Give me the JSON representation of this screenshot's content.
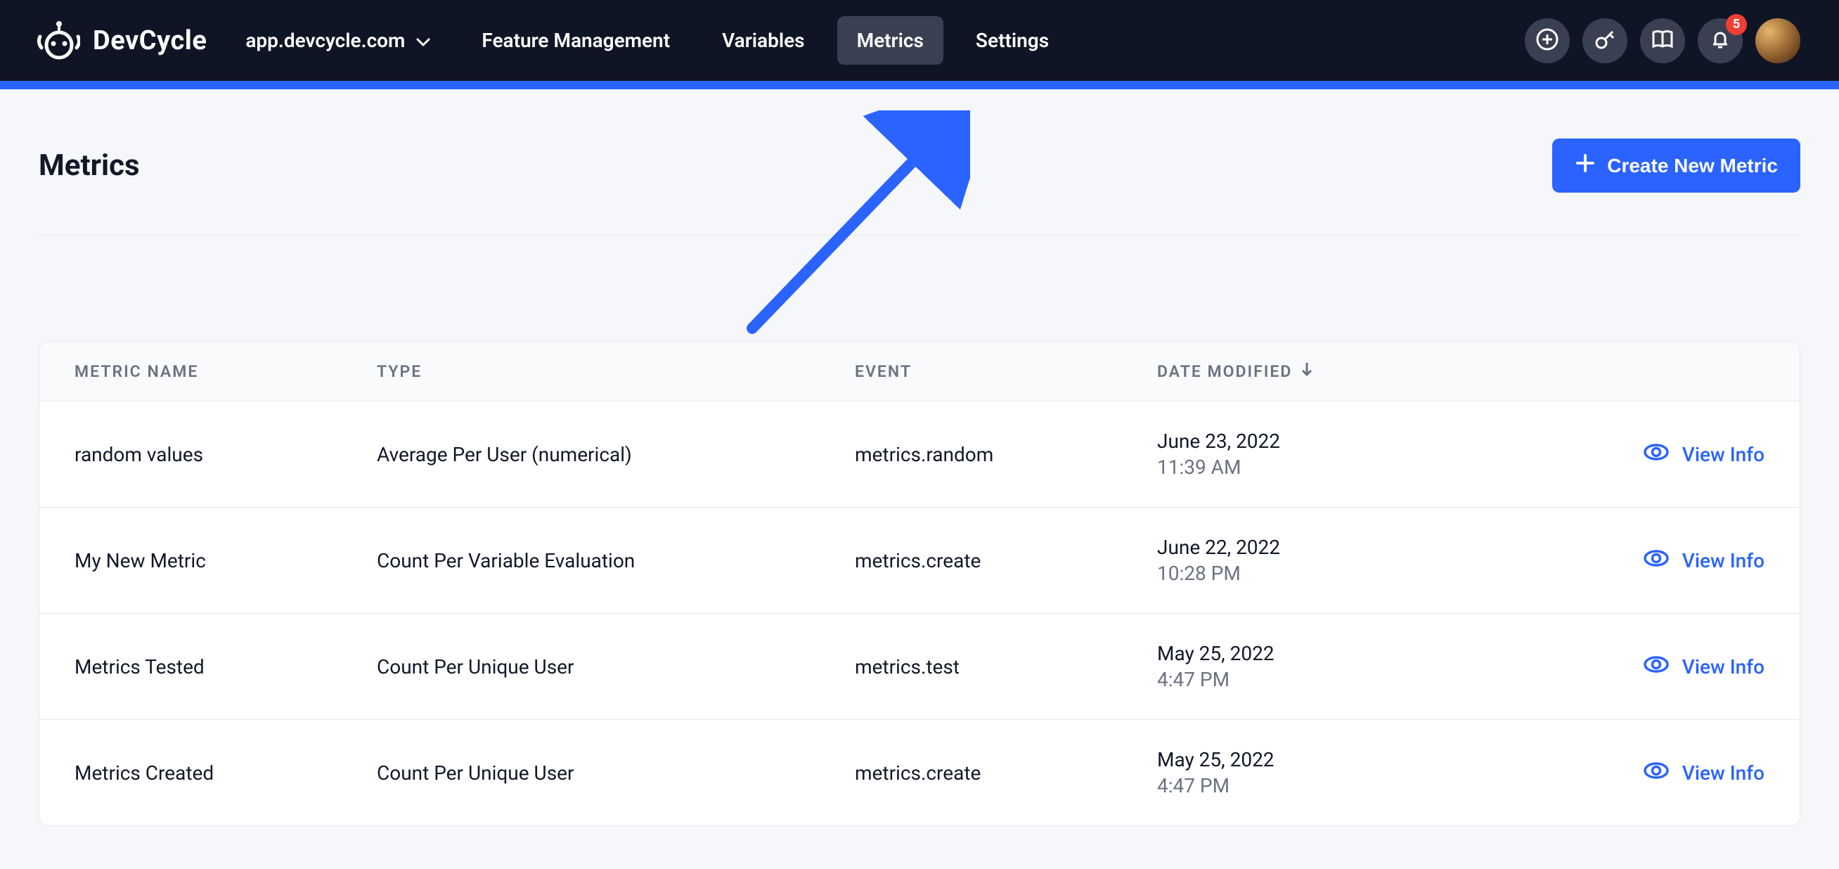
{
  "brand": {
    "name": "DevCycle"
  },
  "topbar": {
    "domain": "app.devcycle.com",
    "nav": [
      {
        "label": "Feature Management",
        "active": false
      },
      {
        "label": "Variables",
        "active": false
      },
      {
        "label": "Metrics",
        "active": true
      },
      {
        "label": "Settings",
        "active": false
      }
    ],
    "notifications_count": "5"
  },
  "page": {
    "title": "Metrics",
    "create_button": "Create New Metric"
  },
  "table": {
    "headers": {
      "name": "METRIC NAME",
      "type": "TYPE",
      "event": "EVENT",
      "date": "DATE MODIFIED"
    },
    "view_action_label": "View Info",
    "rows": [
      {
        "name": "random values",
        "type": "Average Per User (numerical)",
        "event": "metrics.random",
        "date": "June 23, 2022",
        "time": "11:39 AM"
      },
      {
        "name": "My New Metric",
        "type": "Count Per Variable Evaluation",
        "event": "metrics.create",
        "date": "June 22, 2022",
        "time": "10:28 PM"
      },
      {
        "name": "Metrics Tested",
        "type": "Count Per Unique User",
        "event": "metrics.test",
        "date": "May 25, 2022",
        "time": "4:47 PM"
      },
      {
        "name": "Metrics Created",
        "type": "Count Per Unique User",
        "event": "metrics.create",
        "date": "May 25, 2022",
        "time": "4:47 PM"
      }
    ]
  },
  "colors": {
    "accent": "#2a63ff",
    "bg_dark": "#0f1524",
    "bg_light": "#f5f7fa",
    "badge": "#ef3e36"
  }
}
